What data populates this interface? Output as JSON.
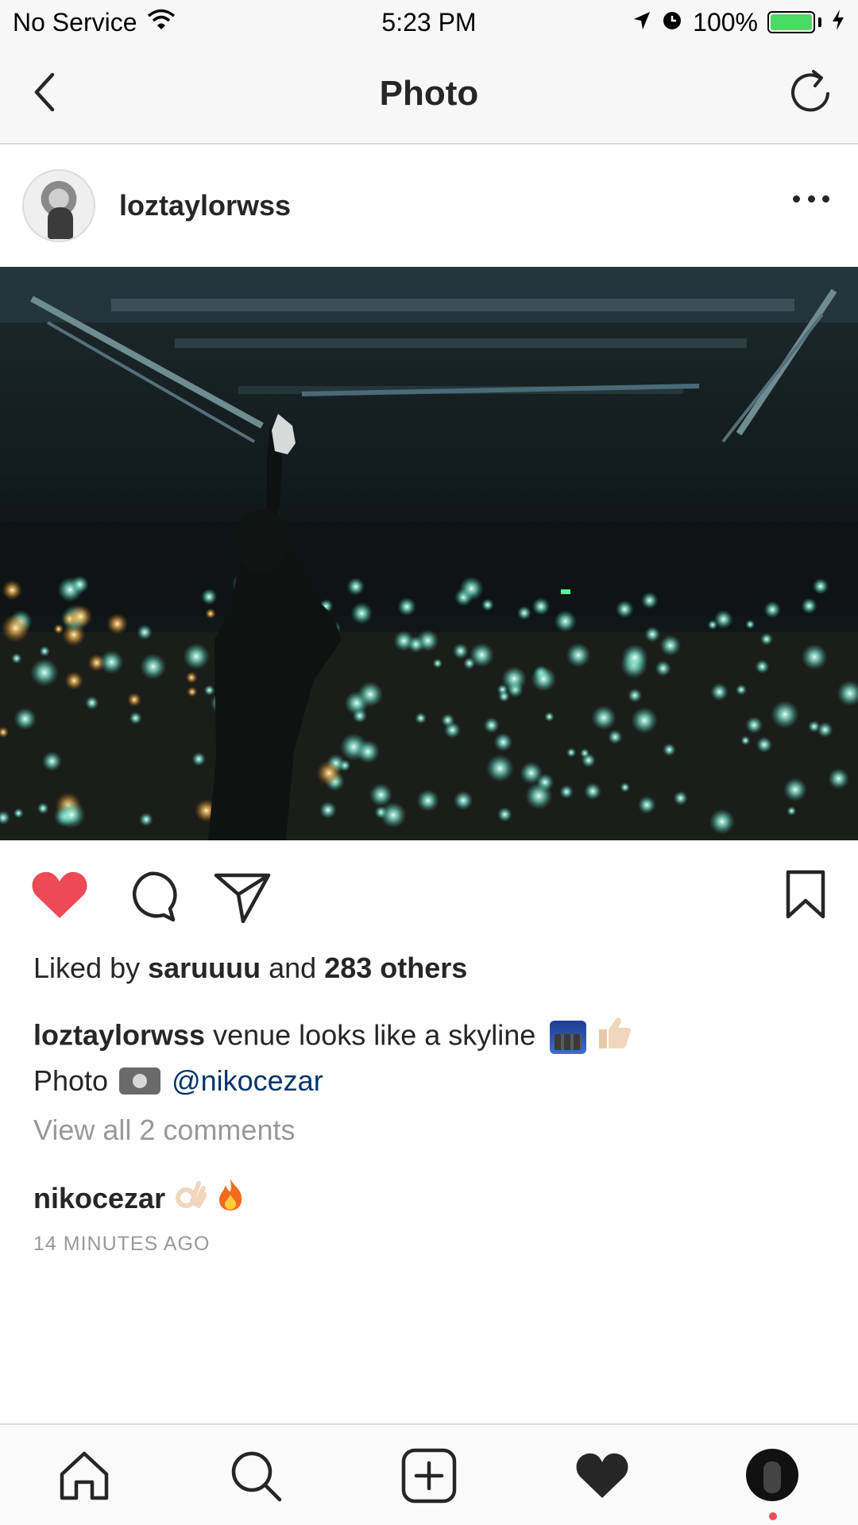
{
  "status_bar": {
    "carrier": "No Service",
    "time": "5:23 PM",
    "battery": "100%",
    "battery_level": 1.0,
    "icons": [
      "wifi-icon",
      "location-icon",
      "alarm-icon",
      "battery-icon",
      "charging-icon"
    ]
  },
  "nav": {
    "title": "Photo",
    "back_icon": "chevron-left-icon",
    "refresh_icon": "refresh-icon"
  },
  "post": {
    "username": "loztaylorwss",
    "more_icon": "more-dots-icon",
    "liked_by_prefix": "Liked by ",
    "liked_by_user": "saruuuu",
    "liked_by_and": " and ",
    "liked_by_others": "283 others",
    "caption_user": "loztaylorwss",
    "caption_text": " venue looks like a skyline",
    "caption_emojis": [
      "cityscape-emoji",
      "thumbs-up-emoji"
    ],
    "photo_credit_label": "Photo",
    "photo_credit_mention": "@nikocezar",
    "view_all_comments": "View all 2 comments",
    "comment_user": "nikocezar",
    "comment_emojis": [
      "ok-hand-emoji",
      "fire-emoji"
    ],
    "time_ago": "14 MINUTES AGO",
    "liked": true
  },
  "colors": {
    "like_red": "#ed4956",
    "link_blue": "#003569",
    "muted_gray": "#999999",
    "text": "#262626"
  },
  "tab_bar": {
    "items": [
      "home-icon",
      "search-icon",
      "add-icon",
      "activity-heart-icon",
      "profile-avatar"
    ]
  }
}
